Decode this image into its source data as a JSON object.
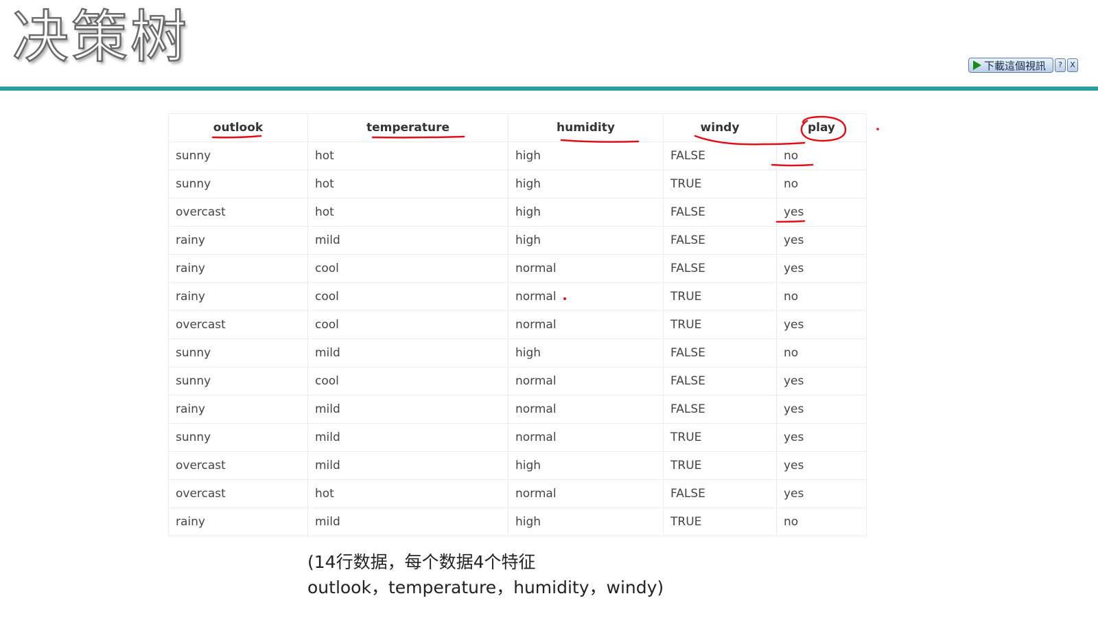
{
  "slide": {
    "title": "决策树"
  },
  "widget": {
    "download_label": "下載這個視訊",
    "help_label": "?",
    "close_label": "X",
    "icons": [
      "play-icon"
    ]
  },
  "table": {
    "headers": [
      "outlook",
      "temperature",
      "humidity",
      "windy",
      "play"
    ],
    "rows": [
      [
        "sunny",
        "hot",
        "high",
        "FALSE",
        "no"
      ],
      [
        "sunny",
        "hot",
        "high",
        "TRUE",
        "no"
      ],
      [
        "overcast",
        "hot",
        "high",
        "FALSE",
        "yes"
      ],
      [
        "rainy",
        "mild",
        "high",
        "FALSE",
        "yes"
      ],
      [
        "rainy",
        "cool",
        "normal",
        "FALSE",
        "yes"
      ],
      [
        "rainy",
        "cool",
        "normal",
        "TRUE",
        "no"
      ],
      [
        "overcast",
        "cool",
        "normal",
        "TRUE",
        "yes"
      ],
      [
        "sunny",
        "mild",
        "high",
        "FALSE",
        "no"
      ],
      [
        "sunny",
        "cool",
        "normal",
        "FALSE",
        "yes"
      ],
      [
        "rainy",
        "mild",
        "normal",
        "FALSE",
        "yes"
      ],
      [
        "sunny",
        "mild",
        "normal",
        "TRUE",
        "yes"
      ],
      [
        "overcast",
        "mild",
        "high",
        "TRUE",
        "yes"
      ],
      [
        "overcast",
        "hot",
        "normal",
        "FALSE",
        "yes"
      ],
      [
        "rainy",
        "mild",
        "high",
        "TRUE",
        "no"
      ]
    ]
  },
  "caption": {
    "line1": "(14行数据，每个数据4个特征",
    "line2": "outlook，temperature，humidity，windy)"
  },
  "colors": {
    "accent_rule": "#2aa0a0",
    "annotation": "#e0101a"
  }
}
